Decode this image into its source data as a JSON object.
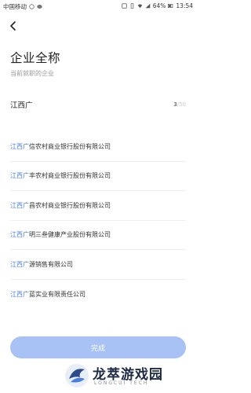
{
  "status_bar": {
    "carrier": "中国移动",
    "battery": "64%",
    "time": "13:54"
  },
  "header": {
    "back_icon": "chevron-left-icon"
  },
  "page": {
    "title": "企业全称",
    "subtitle": "当前就职的企业"
  },
  "input": {
    "value": "江西广",
    "count": "3",
    "max": "/50"
  },
  "suggestions": [
    {
      "match": "江西广",
      "rest": "信农村商业银行股份有限公司"
    },
    {
      "match": "江西广",
      "rest": "丰农村商业银行股份有限公司"
    },
    {
      "match": "江西广",
      "rest": "昌农村商业银行股份有限公司"
    },
    {
      "match": "江西广",
      "rest": "明三叁健康产业股份有限公司"
    },
    {
      "match": "江西广",
      "rest": "源销售有限公司"
    },
    {
      "match": "江西广",
      "rest": "蓝实业有限责任公司"
    }
  ],
  "done_button": {
    "label": "完成"
  },
  "watermark": {
    "title": "龙萃游戏园",
    "subtitle": "LONGCUI TECH"
  },
  "colors": {
    "highlight": "#4a7fe0",
    "button_bg": "#a8c2f5"
  }
}
